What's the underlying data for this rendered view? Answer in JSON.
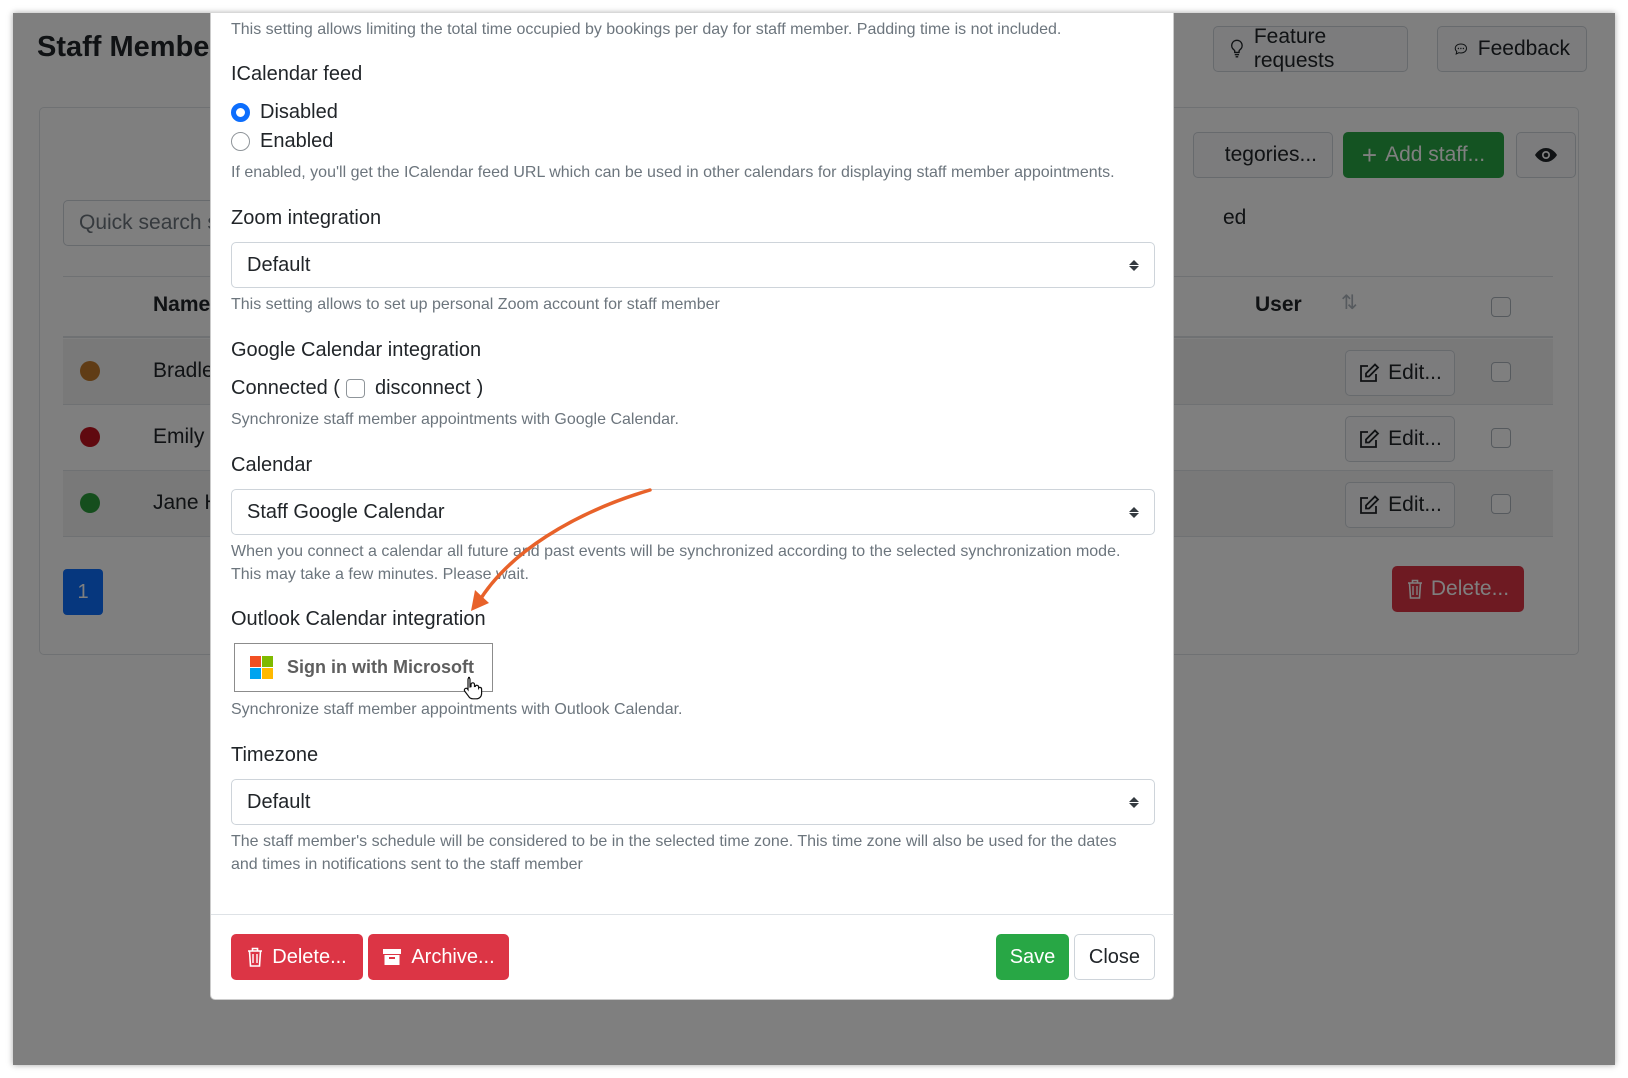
{
  "background": {
    "page_title": "Staff Membe",
    "header_buttons": {
      "feature_requests": "Feature requests",
      "feedback": "Feedback"
    },
    "quick_search_placeholder": "Quick search s",
    "categories_button": "tegories...",
    "add_staff_button": "Add staff...",
    "filter_fragment": "ed",
    "table": {
      "columns": {
        "name": "Name",
        "user": "User"
      },
      "rows": [
        {
          "name": "Bradley",
          "color": "#c0792a",
          "edit": "Edit..."
        },
        {
          "name": "Emily Ta",
          "color": "#c1121f",
          "edit": "Edit..."
        },
        {
          "name": "Jane Ho",
          "color": "#2a9d3a",
          "edit": "Edit..."
        }
      ]
    },
    "pagination_current": "1",
    "delete_button": "Delete..."
  },
  "modal": {
    "limit_help": "This setting allows limiting the total time occupied by bookings per day for staff member. Padding time is not included.",
    "icalendar": {
      "label": "ICalendar feed",
      "options": [
        {
          "label": "Disabled",
          "selected": true
        },
        {
          "label": "Enabled",
          "selected": false
        }
      ],
      "help": "If enabled, you'll get the ICalendar feed URL which can be used in other calendars for displaying staff member appointments."
    },
    "zoom": {
      "label": "Zoom integration",
      "value": "Default",
      "help": "This setting allows to set up personal Zoom account for staff member"
    },
    "google": {
      "label": "Google Calendar integration",
      "status_prefix": "Connected (",
      "disconnect_label": "disconnect",
      "status_suffix": ")",
      "help": "Synchronize staff member appointments with Google Calendar."
    },
    "calendar": {
      "label": "Calendar",
      "value": "Staff Google Calendar",
      "help_line1": "When you connect a calendar all future and past events will be synchronized according to the selected synchronization mode.",
      "help_line2": "This may take a few minutes. Please wait."
    },
    "outlook": {
      "label": "Outlook Calendar integration",
      "sign_in_button": "Sign in with Microsoft",
      "help": "Synchronize staff member appointments with Outlook Calendar.",
      "logo_colors": [
        "#f25022",
        "#7fba00",
        "#00a4ef",
        "#ffb900"
      ]
    },
    "timezone": {
      "label": "Timezone",
      "value": "Default",
      "help_line1": "The staff member's schedule will be considered to be in the selected time zone. This time zone will also be used for the dates",
      "help_line2": "and times in notifications sent to the staff member"
    },
    "footer": {
      "delete": "Delete...",
      "archive": "Archive...",
      "save": "Save",
      "close": "Close"
    }
  },
  "colors": {
    "primary": "#0d6efd",
    "success": "#28a745",
    "danger": "#dc3545",
    "annotation_arrow": "#e8622a"
  }
}
